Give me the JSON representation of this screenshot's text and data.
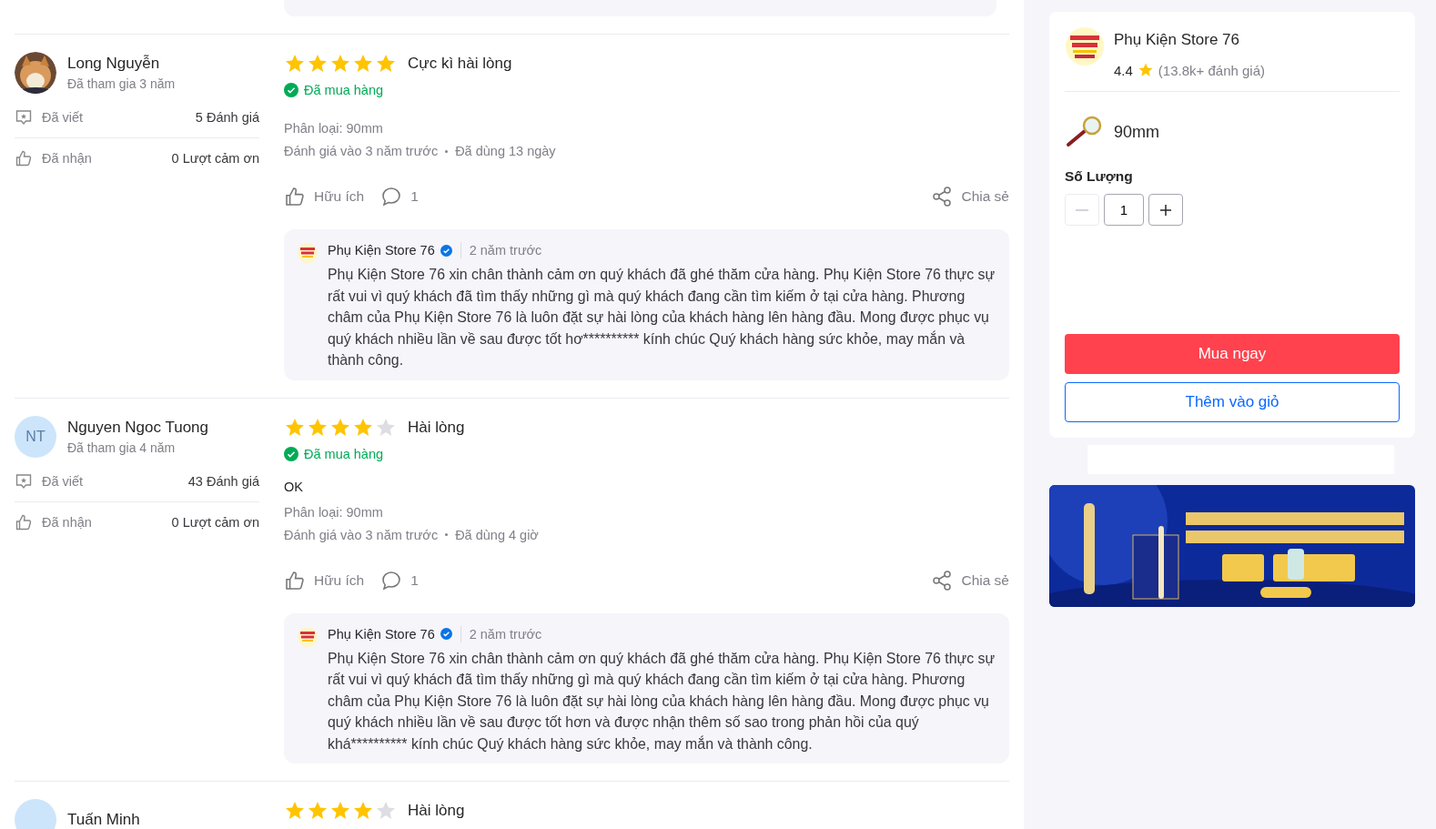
{
  "reviews": [
    {
      "user": {
        "name": "Long Nguyễn",
        "joined": "Đã tham gia 3 năm"
      },
      "stats": [
        {
          "kind": "written",
          "label": "Đã viết",
          "value": "5 Đánh giá"
        },
        {
          "kind": "received",
          "label": "Đã nhận",
          "value": "0 Lượt cảm ơn"
        }
      ],
      "stars": 5,
      "title": "Cực kì hài lòng",
      "purchased": "Đã mua hàng",
      "variant": "Phân loại: 90mm",
      "meta": [
        "Đánh giá vào 3 năm trước",
        "Đã dùng 13 ngày"
      ],
      "helpful": "Hữu ích",
      "comments": "1",
      "share": "Chia sẻ",
      "reply": {
        "shop": "Phụ Kiện Store 76",
        "verified": true,
        "time": "2 năm trước",
        "text": "Phụ Kiện Store 76 xin chân thành cảm ơn quý khách đã ghé thăm cửa hàng. Phụ Kiện Store 76 thực sự rất vui vì quý khách đã tìm thấy những gì mà quý khách đang cần tìm kiếm ở tại cửa hàng. Phương châm của Phụ Kiện Store 76 là luôn đặt sự hài lòng của khách hàng lên hàng đầu. Mong được phục vụ quý khách nhiều lần về sau được tốt hơ********** kính chúc Quý khách hàng sức khỏe, may mắn và thành công."
      }
    },
    {
      "user": {
        "name": "Nguyen Ngoc Tuong",
        "joined": "Đã tham gia 4 năm",
        "avatar": {
          "kind": "initials",
          "text": "NT"
        }
      },
      "stats": [
        {
          "kind": "written",
          "label": "Đã viết",
          "value": "43 Đánh giá"
        },
        {
          "kind": "received",
          "label": "Đã nhận",
          "value": "0 Lượt cảm ơn"
        }
      ],
      "stars": 4,
      "title": "Hài lòng",
      "purchased": "Đã mua hàng",
      "comment": "OK",
      "variant": "Phân loại: 90mm",
      "meta": [
        "Đánh giá vào 3 năm trước",
        "Đã dùng 4 giờ"
      ],
      "helpful": "Hữu ích",
      "comments": "1",
      "share": "Chia sẻ",
      "reply": {
        "shop": "Phụ Kiện Store 76",
        "verified": true,
        "time": "2 năm trước",
        "text": "Phụ Kiện Store 76 xin chân thành cảm ơn quý khách đã ghé thăm cửa hàng. Phụ Kiện Store 76 thực sự rất vui vì quý khách đã tìm thấy những gì mà quý khách đang cần tìm kiếm ở tại cửa hàng. Phương châm của Phụ Kiện Store 76 là luôn đặt sự hài lòng của khách hàng lên hàng đầu. Mong được phục vụ quý khách nhiều lần về sau được tốt hơn và được nhận thêm số sao trong phản hồi của quý khá********** kính chúc Quý khách hàng sức khỏe, may mắn và thành công."
      }
    },
    {
      "user": {
        "name": "Tuấn Minh",
        "avatar": {
          "kind": "initials"
        }
      },
      "stars": 4,
      "title": "Hài lòng"
    }
  ],
  "store": {
    "name": "Phụ Kiện Store 76",
    "rating": "4.4",
    "count": "(13.8k+ đánh giá)",
    "option": "90mm",
    "quantity_label": "Số Lượng",
    "quantity": "1",
    "minus_disabled": true,
    "buy": "Mua ngay",
    "add_to_cart": "Thêm vào giỏ"
  }
}
